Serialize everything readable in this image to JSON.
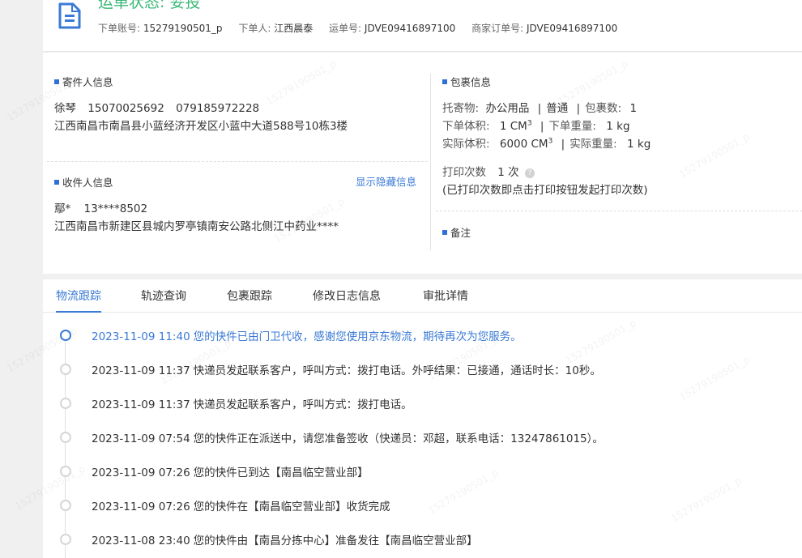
{
  "header": {
    "status_title": "运单状态: 妥投",
    "meta": [
      {
        "label": "下单账号:",
        "value": "15279190501_p"
      },
      {
        "label": "下单人:",
        "value": "江西晨泰"
      },
      {
        "label": "运单号:",
        "value": "JDVE09416897100"
      },
      {
        "label": "商家订单号:",
        "value": "JDVE09416897100"
      }
    ]
  },
  "sender": {
    "title": "寄件人信息",
    "name": "徐琴",
    "phone1": "15070025692",
    "phone2": "079185972228",
    "address": "江西南昌市南昌县小蓝经济开发区小蓝中大道588号10栋3楼"
  },
  "receiver": {
    "title": "收件人信息",
    "toggle_link": "显示隐藏信息",
    "name": "鄢*",
    "phone": "13****8502",
    "address": "江西南昌市新建区县城内罗亭镇南安公路北侧江中药业****"
  },
  "package": {
    "title": "包裹信息",
    "contents_label": "托寄物:",
    "contents_value": "办公用品",
    "service": "普通",
    "count_label": "包裹数:",
    "count_value": "1",
    "order_volume_label": "下单体积:",
    "order_volume_value": "1 CM",
    "order_weight_label": "下单重量:",
    "order_weight_value": "1 kg",
    "actual_volume_label": "实际体积:",
    "actual_volume_value": "6000 CM",
    "actual_weight_label": "实际重量:",
    "actual_weight_value": "1 kg",
    "volume_exponent": "3",
    "print_label": "打印次数",
    "print_value": "1 次",
    "print_note": "(已打印次数即点击打印按钮发起打印次数)"
  },
  "remarks": {
    "title": "备注"
  },
  "tabs": [
    "物流跟踪",
    "轨迹查询",
    "包裹跟踪",
    "修改日志信息",
    "审批详情"
  ],
  "active_tab_index": 0,
  "timeline": [
    {
      "time": "2023-11-09 11:40",
      "text": "您的快件已由门卫代收，感谢您使用京东物流，期待再次为您服务。"
    },
    {
      "time": "2023-11-09 11:37",
      "text": "快递员发起联系客户，呼叫方式：拨打电话。外呼结果：已接通，通话时长：10秒。"
    },
    {
      "time": "2023-11-09 11:37",
      "text": "快递员发起联系客户，呼叫方式：拨打电话。"
    },
    {
      "time": "2023-11-09 07:54",
      "text": "您的快件正在派送中，请您准备签收（快递员：邓超，联系电话：13247861015）。"
    },
    {
      "time": "2023-11-09 07:26",
      "text": "您的快件已到达【南昌临空营业部】"
    },
    {
      "time": "2023-11-09 07:26",
      "text": "您的快件在【南昌临空营业部】收货完成"
    },
    {
      "time": "2023-11-08 23:40",
      "text": "您的快件由【南昌分拣中心】准备发往【南昌临空营业部】"
    }
  ],
  "watermark": "15279190501_p",
  "colors": {
    "accent": "#3a7ad6",
    "status_green": "#3cb878",
    "marker": "#2f6fd6"
  }
}
